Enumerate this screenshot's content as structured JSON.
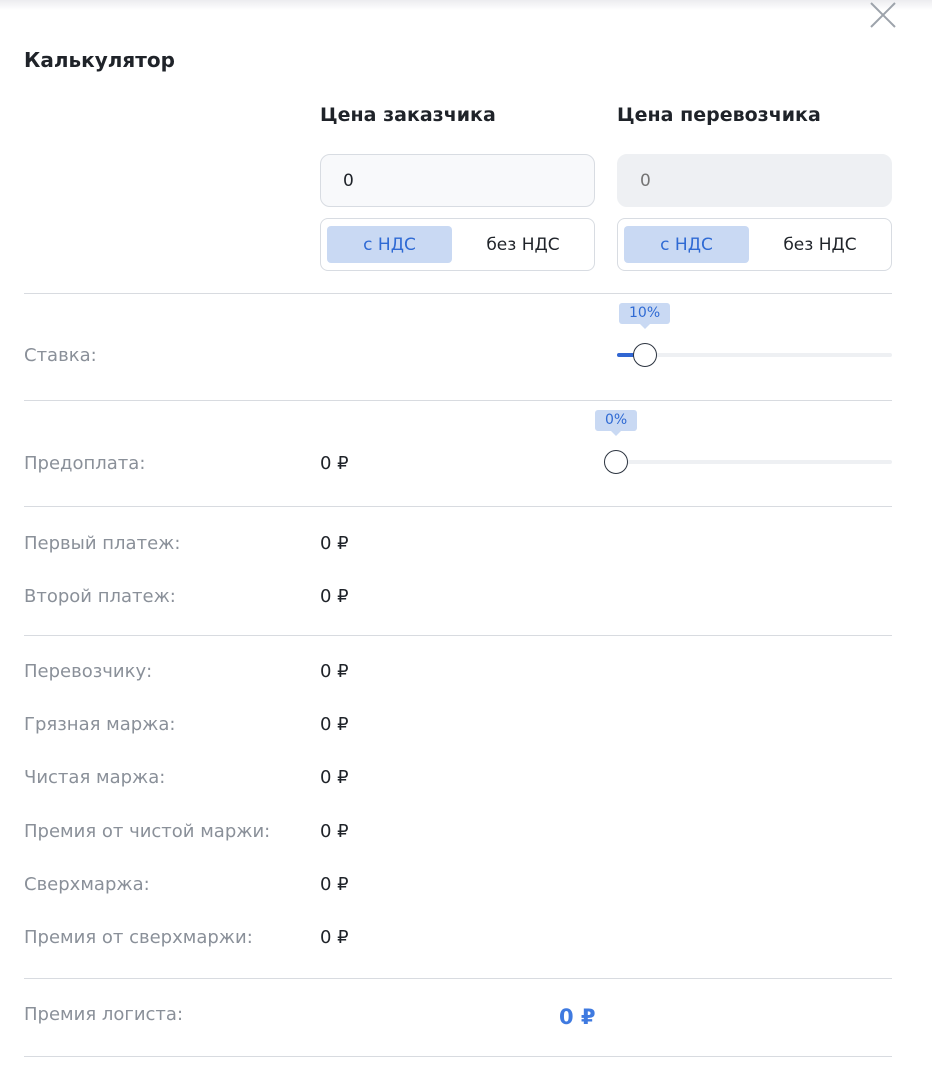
{
  "title": "Калькулятор",
  "customer": {
    "header": "Цена заказчика",
    "value": "0",
    "with_vat": "с НДС",
    "without_vat": "без НДС"
  },
  "carrier": {
    "header": "Цена перевозчика",
    "placeholder": "0",
    "with_vat": "с НДС",
    "without_vat": "без НДС"
  },
  "rate": {
    "label": "Ставка:",
    "tooltip": "10%",
    "fraction": 0.1
  },
  "prepayment": {
    "label": "Предоплата:",
    "value": "0 ₽",
    "tooltip": "0%",
    "fraction": 0.0
  },
  "payments": [
    {
      "label": "Первый платеж:",
      "value": "0 ₽"
    },
    {
      "label": "Второй платеж:",
      "value": "0 ₽"
    }
  ],
  "margins": [
    {
      "label": "Перевозчику:",
      "value": "0 ₽"
    },
    {
      "label": "Грязная маржа:",
      "value": "0 ₽"
    },
    {
      "label": "Чистая маржа:",
      "value": "0 ₽"
    },
    {
      "label": "Премия от чистой маржи:",
      "value": "0 ₽"
    },
    {
      "label": "Сверхмаржа:",
      "value": "0 ₽"
    },
    {
      "label": "Премия от сверхмаржи:",
      "value": "0 ₽"
    }
  ],
  "logist_bonus": {
    "label": "Премия логиста:",
    "value": "0 ₽"
  },
  "colors": {
    "accent": "#3166d2",
    "accent_light": "#c9d9f3",
    "label": "#8a9099",
    "bonus": "#3f7ae0"
  },
  "icons": {
    "close": "close-icon"
  }
}
